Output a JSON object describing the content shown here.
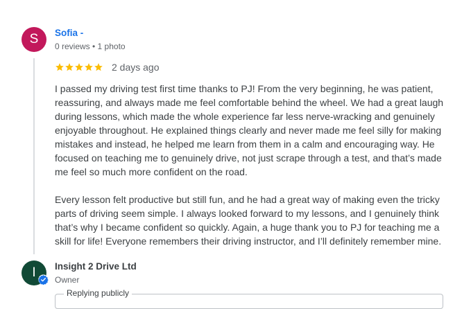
{
  "review": {
    "avatar_letter": "S",
    "reviewer_name": "Sofia -",
    "reviewer_meta": "0 reviews • 1 photo",
    "rating_stars": 5,
    "date": "2 days ago",
    "paragraphs": [
      "I passed my driving test first time thanks to PJ! From the very beginning, he was patient, reassuring, and always made me feel comfortable behind the wheel. We had a great laugh during lessons, which made the whole experience far less nerve-wracking and genuinely enjoyable throughout. He explained things clearly and never made me feel silly for making mistakes and instead, he helped me learn from them in a calm and encouraging way. He focused on teaching me to genuinely drive, not just scrape through a test, and that’s made me feel so much more confident on the road.",
      "Every lesson felt productive but still fun, and he had a great way of making even the tricky parts of driving seem simple. I always looked forward to my lessons, and I genuinely think that’s why I became confident so quickly. Again, a huge thank you to PJ for teaching me a skill for life! Everyone remembers their driving instructor, and I’ll definitely remember mine."
    ]
  },
  "owner_reply": {
    "avatar_letter": "I",
    "name": "Insight 2 Drive Ltd",
    "role": "Owner",
    "reply_legend": "Replying publicly"
  },
  "colors": {
    "reviewer_avatar": "#c2185b",
    "owner_avatar": "#114a36",
    "star": "#fbbc04",
    "link": "#1a73e8",
    "verified": "#1a73e8"
  },
  "icons": {
    "star": "star-icon",
    "verified": "verified-check-icon"
  }
}
